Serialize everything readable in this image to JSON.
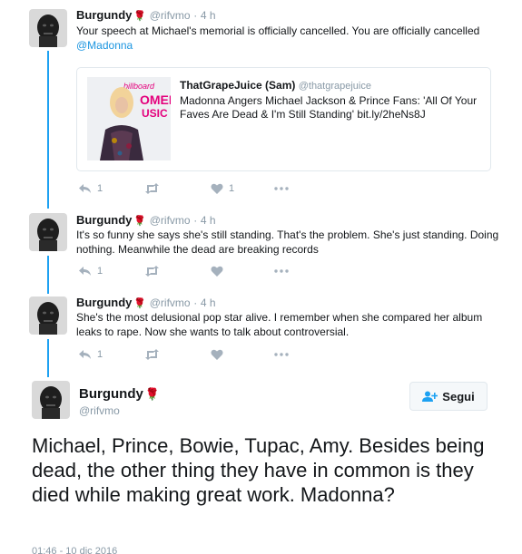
{
  "tweets": [
    {
      "name": "Burgundy",
      "rose": "🌹",
      "handle": "@rifvmo",
      "dot": "·",
      "time": "4 h",
      "text": "Your speech at Michael's memorial is officially cancelled. You are officially cancelled ",
      "mention": "@Madonna",
      "reply_count": "1",
      "retweet_count": "",
      "like_count": "1"
    },
    {
      "name": "Burgundy",
      "rose": "🌹",
      "handle": "@rifvmo",
      "dot": "·",
      "time": "4 h",
      "text": "It's so funny she says she's still standing. That's the problem. She's just standing. Doing nothing. Meanwhile the dead are breaking records",
      "reply_count": "1",
      "retweet_count": "",
      "like_count": ""
    },
    {
      "name": "Burgundy",
      "rose": "🌹",
      "handle": "@rifvmo",
      "dot": "·",
      "time": "4 h",
      "text": "She's the most delusional pop star alive. I remember when she compared her album leaks to rape. Now she wants to talk about controversial.",
      "reply_count": "1",
      "retweet_count": "",
      "like_count": ""
    }
  ],
  "card": {
    "source_name": "ThatGrapeJuice (Sam)",
    "source_handle": "@thatgrapejuice",
    "text": "Madonna Angers Michael Jackson & Prince Fans:  'All Of Your Faves Are Dead & I'm Still Standing' bit.ly/2heNs8J",
    "image_text": "billboard WOMEN MUSIC"
  },
  "main": {
    "name": "Burgundy",
    "rose": "🌹",
    "handle": "@rifvmo",
    "follow_label": "Segui",
    "text": "Michael, Prince, Bowie, Tupac, Amy. Besides being dead, the other thing they have in common is they died while making great work. Madonna?",
    "timestamp": "01:46 - 10 dic 2016"
  },
  "colors": {
    "accent": "#1da1f2",
    "mention": "#1b95e0",
    "muted": "#8899a6",
    "rose": "#c0182a"
  },
  "icons": [
    "reply-icon",
    "retweet-icon",
    "heart-icon",
    "more-icon",
    "add-user-icon",
    "rose-emoji"
  ]
}
